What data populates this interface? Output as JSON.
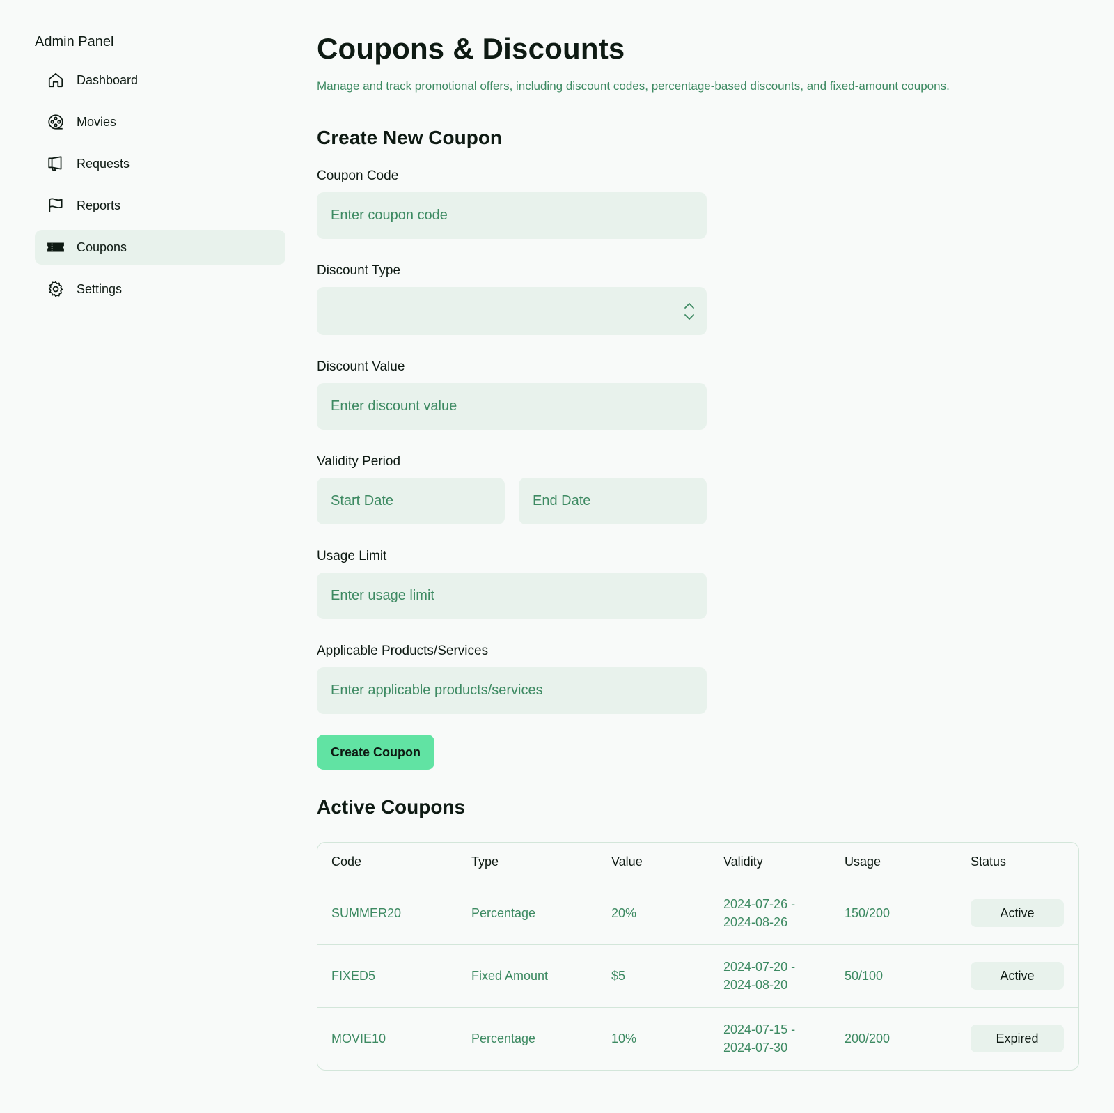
{
  "sidebar": {
    "title": "Admin Panel",
    "items": [
      {
        "label": "Dashboard",
        "icon": "house-icon",
        "active": false
      },
      {
        "label": "Movies",
        "icon": "film-reel-icon",
        "active": false
      },
      {
        "label": "Requests",
        "icon": "megaphone-icon",
        "active": false
      },
      {
        "label": "Reports",
        "icon": "flag-icon",
        "active": false
      },
      {
        "label": "Coupons",
        "icon": "ticket-icon",
        "active": true
      },
      {
        "label": "Settings",
        "icon": "gear-icon",
        "active": false
      }
    ]
  },
  "header": {
    "title": "Coupons & Discounts",
    "subtitle": "Manage and track promotional offers, including discount codes, percentage-based discounts, and fixed-amount coupons."
  },
  "form": {
    "title": "Create New Coupon",
    "coupon_code": {
      "label": "Coupon Code",
      "placeholder": "Enter coupon code",
      "value": ""
    },
    "discount_type": {
      "label": "Discount Type",
      "value": ""
    },
    "discount_value": {
      "label": "Discount Value",
      "placeholder": "Enter discount value",
      "value": ""
    },
    "validity": {
      "label": "Validity Period",
      "start_placeholder": "Start Date",
      "end_placeholder": "End Date"
    },
    "usage_limit": {
      "label": "Usage Limit",
      "placeholder": "Enter usage limit",
      "value": ""
    },
    "products": {
      "label": "Applicable Products/Services",
      "placeholder": "Enter applicable products/services",
      "value": ""
    },
    "submit_label": "Create Coupon"
  },
  "active_coupons": {
    "title": "Active Coupons",
    "columns": [
      "Code",
      "Type",
      "Value",
      "Validity",
      "Usage",
      "Status"
    ],
    "rows": [
      {
        "code": "SUMMER20",
        "type": "Percentage",
        "value": "20%",
        "validity_start": "2024-07-26 -",
        "validity_end": "2024-08-26",
        "usage": "150/200",
        "status": "Active"
      },
      {
        "code": "FIXED5",
        "type": "Fixed Amount",
        "value": "$5",
        "validity_start": "2024-07-20 -",
        "validity_end": "2024-08-20",
        "usage": "50/100",
        "status": "Active"
      },
      {
        "code": "MOVIE10",
        "type": "Percentage",
        "value": "10%",
        "validity_start": "2024-07-15 -",
        "validity_end": "2024-07-30",
        "usage": "200/200",
        "status": "Expired"
      }
    ]
  },
  "colors": {
    "background": "#f8faf9",
    "accent": "#61e3a3",
    "muted_text": "#3d8a62",
    "field_bg": "#e8f2ec",
    "text": "#0e1a13"
  }
}
